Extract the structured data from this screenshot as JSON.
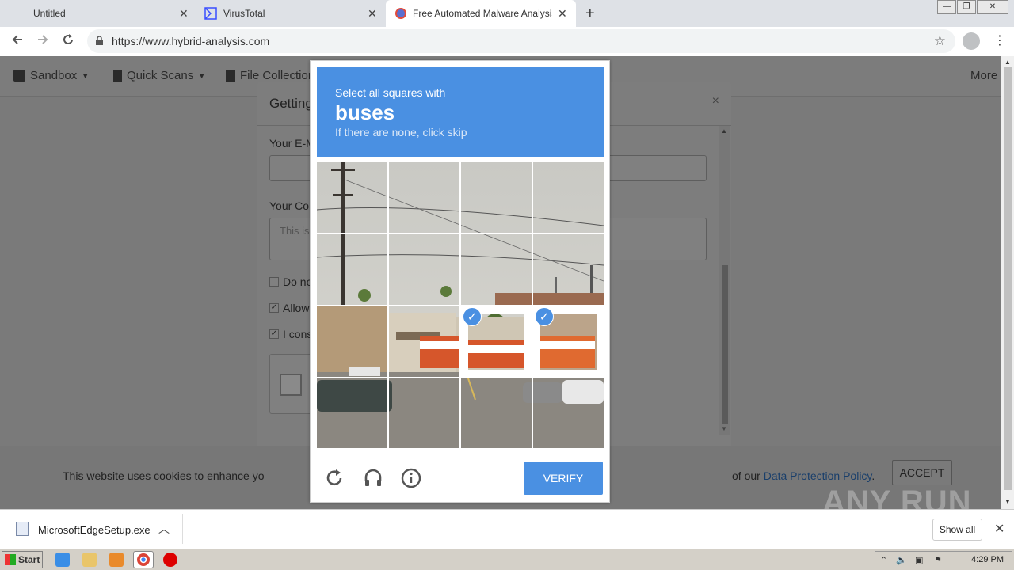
{
  "browser": {
    "tabs": [
      {
        "title": "Untitled",
        "close": "✕"
      },
      {
        "title": "VirusTotal",
        "close": "✕"
      },
      {
        "title": "Free Automated Malware Analysis Se",
        "close": "✕"
      }
    ],
    "new_tab": "+",
    "url": "https://www.hybrid-analysis.com",
    "window_controls": [
      "—",
      "❐",
      "✕"
    ]
  },
  "site_nav": {
    "items": [
      {
        "label": "Sandbox",
        "icon": "cube-icon"
      },
      {
        "label": "Quick Scans",
        "icon": "file-icon"
      },
      {
        "label": "File Collection",
        "icon": "files-icon"
      }
    ],
    "more": "More"
  },
  "modal": {
    "title": "Getting",
    "email_label": "Your E-M",
    "comment_label": "Your Con",
    "comment_placeholder": "This is",
    "checkboxes": [
      {
        "label": "Do no",
        "checked": false
      },
      {
        "label": "Allow",
        "checked": true
      },
      {
        "label": "I cons",
        "checked": true
      }
    ],
    "close": "×"
  },
  "cookie_banner": {
    "text_left": "This website uses cookies to enhance yo",
    "text_right_prefix": "of our ",
    "link": "Data Protection Policy",
    "link_suffix": ".",
    "accept": "ACCEPT"
  },
  "recaptcha": {
    "instruction": "Select all squares with",
    "object": "buses",
    "hint": "If there are none, click skip",
    "selected_tiles": [
      10,
      11
    ],
    "verify": "VERIFY"
  },
  "download_bar": {
    "filename": "MicrosoftEdgeSetup.exe",
    "show_all": "Show all"
  },
  "watermark": "ANY RUN",
  "taskbar": {
    "start": "Start",
    "clock": "4:29 PM"
  },
  "colors": {
    "recaptcha_blue": "#4a90e2",
    "overlay_gray": "#7a7a7a",
    "primary_button": "#1f4e7a"
  }
}
